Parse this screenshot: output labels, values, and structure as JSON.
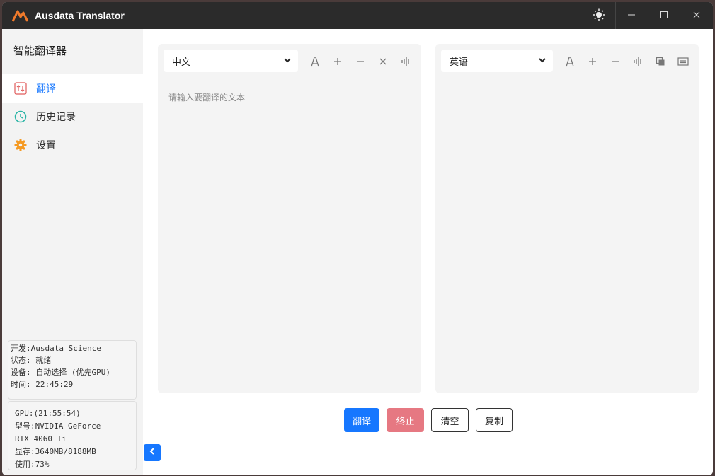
{
  "app": {
    "title": "Ausdata Translator"
  },
  "sidebar": {
    "title": "智能翻译器",
    "items": [
      {
        "label": "翻译",
        "icon": "swap-arrows-icon",
        "active": true
      },
      {
        "label": "历史记录",
        "icon": "clock-icon",
        "active": false
      },
      {
        "label": "设置",
        "icon": "gear-icon",
        "active": false
      }
    ],
    "info": {
      "developer": "开发:Ausdata Science",
      "status": "状态: 就绪",
      "device": "设备: 自动选择 (优先GPU)",
      "time": "时间: 22:45:29"
    },
    "gpu": {
      "timestamp": "GPU:(21:55:54)",
      "model_line1": "型号:NVIDIA GeForce",
      "model_line2": "RTX 4060 Ti",
      "memory": "显存:3640MB/8188MB",
      "usage": "使用:73%"
    }
  },
  "source": {
    "language": "中文",
    "placeholder": "请输入要翻译的文本",
    "tools": [
      "font-icon",
      "plus-icon",
      "minus-icon",
      "close-icon",
      "voice-icon"
    ]
  },
  "target": {
    "language": "英语",
    "tools": [
      "font-icon",
      "plus-icon",
      "minus-icon",
      "voice-icon",
      "copy-icon",
      "text-icon"
    ]
  },
  "actions": {
    "translate": "翻译",
    "stop": "终止",
    "clear": "清空",
    "copy": "复制"
  },
  "colors": {
    "accent": "#1677ff",
    "stop": "#e67882",
    "titlebar": "#2b2b2b",
    "history_icon": "#2bb5a6",
    "settings_icon": "#f59a23",
    "translate_icon": "#e05a5a"
  }
}
